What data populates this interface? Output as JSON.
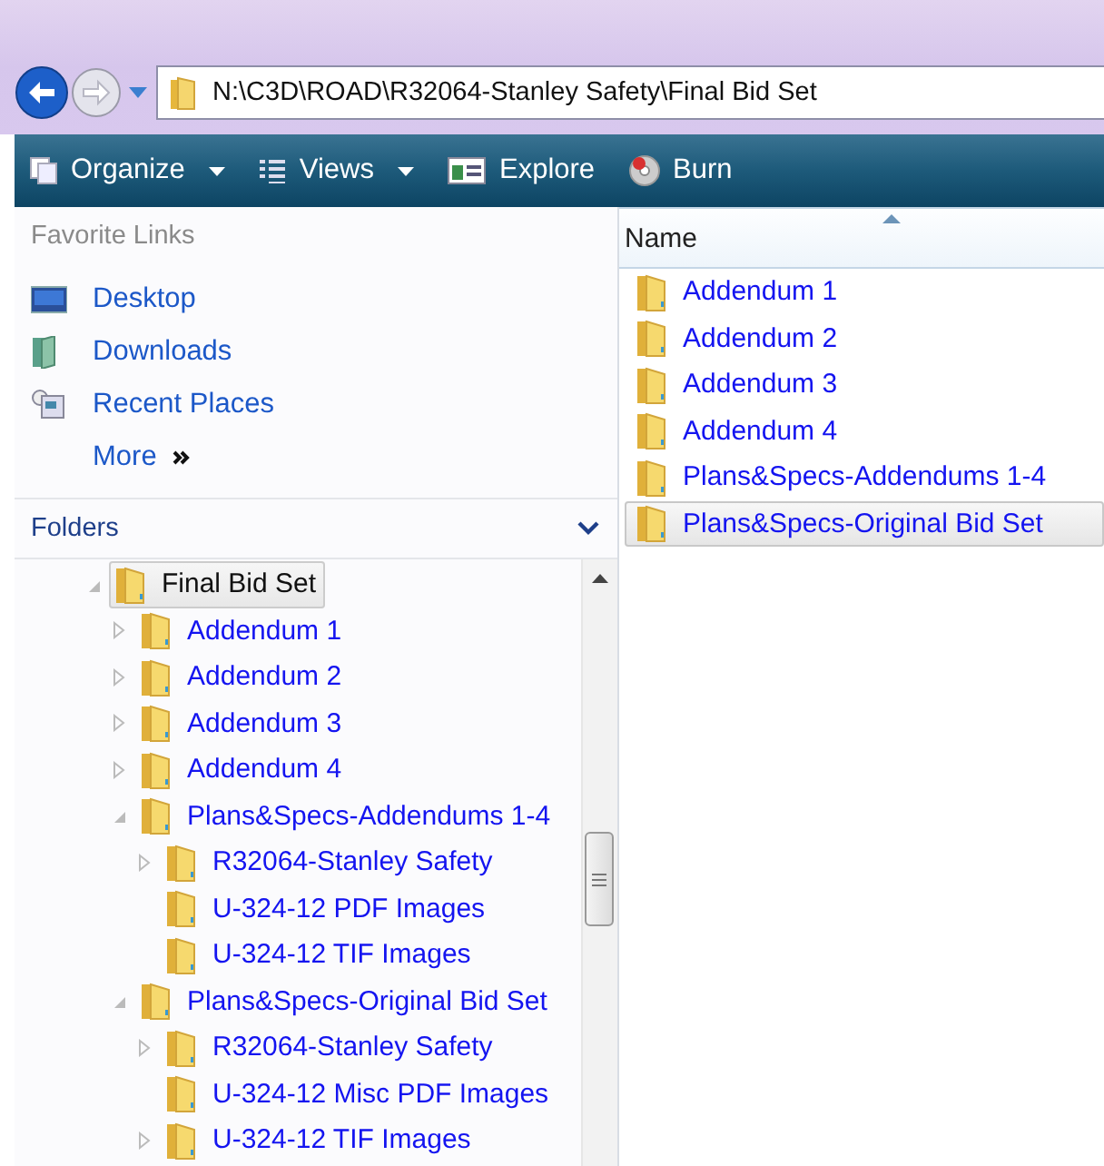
{
  "address_bar": {
    "path": "N:\\C3D\\ROAD\\R32064-Stanley Safety\\Final Bid Set"
  },
  "toolbar": [
    {
      "label": "Organize",
      "kind": "menu"
    },
    {
      "label": "Views",
      "kind": "menu"
    },
    {
      "label": "Explore",
      "kind": "button"
    },
    {
      "label": "Burn",
      "kind": "button"
    }
  ],
  "favorite_links": {
    "title": "Favorite Links",
    "items": [
      {
        "label": "Desktop",
        "kind": "desktop"
      },
      {
        "label": "Downloads",
        "kind": "downloads"
      },
      {
        "label": "Recent Places",
        "kind": "recent"
      },
      {
        "label": "More",
        "kind": "more"
      }
    ]
  },
  "folders": {
    "title": "Folders",
    "tree": [
      {
        "label": "Final Bid Set",
        "expanded": true,
        "selected": true,
        "children": [
          {
            "label": "Addendum 1",
            "expanded": false,
            "selected": false
          },
          {
            "label": "Addendum 2",
            "expanded": false,
            "selected": false
          },
          {
            "label": "Addendum 3",
            "expanded": false,
            "selected": false
          },
          {
            "label": "Addendum 4",
            "expanded": false,
            "selected": false
          },
          {
            "label": "Plans&Specs-Addendums 1-4",
            "expanded": true,
            "selected": false,
            "children": [
              {
                "label": "R32064-Stanley Safety",
                "expanded": false,
                "selected": false
              },
              {
                "label": "U-324-12 PDF Images",
                "selected": false
              },
              {
                "label": "U-324-12 TIF Images",
                "selected": false
              }
            ]
          },
          {
            "label": "Plans&Specs-Original Bid Set",
            "expanded": true,
            "selected": false,
            "children": [
              {
                "label": "R32064-Stanley Safety",
                "expanded": false,
                "selected": false
              },
              {
                "label": "U-324-12 Misc PDF Images",
                "selected": false
              },
              {
                "label": "U-324-12 TIF Images",
                "expanded": false,
                "selected": false
              }
            ]
          }
        ]
      }
    ]
  },
  "file_list": {
    "columns": [
      "Name"
    ],
    "rows": [
      {
        "name": "Addendum 1",
        "selected": false
      },
      {
        "name": "Addendum 2",
        "selected": false
      },
      {
        "name": "Addendum 3",
        "selected": false
      },
      {
        "name": "Addendum 4",
        "selected": false
      },
      {
        "name": "Plans&Specs-Addendums 1-4",
        "selected": false
      },
      {
        "name": "Plans&Specs-Original Bid Set",
        "selected": true
      }
    ]
  }
}
